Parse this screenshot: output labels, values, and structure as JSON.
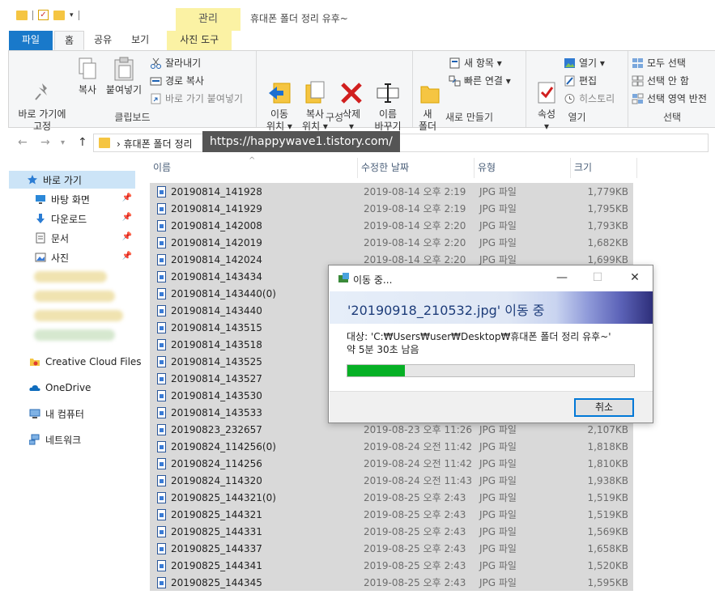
{
  "window": {
    "title": "휴대폰 폴더 정리 유후~",
    "contextual_tab": "관리"
  },
  "tabs": [
    "파일",
    "홈",
    "공유",
    "보기",
    "사진 도구"
  ],
  "ribbon": {
    "clipboard": {
      "pin": "바로 가기에\n고정",
      "copy": "복사",
      "paste": "붙여넣기",
      "cut": "잘라내기",
      "copy_path": "경로 복사",
      "paste_shortcut": "바로 가기 붙여넣기",
      "label": "클립보드"
    },
    "organize": {
      "move": "이동\n위치 ▾",
      "copy_to": "복사\n위치 ▾",
      "delete": "삭제\n▾",
      "rename": "이름\n바꾸기",
      "label": "구성"
    },
    "new": {
      "new_folder": "새\n폴더",
      "new_item": "새 항목 ▾",
      "easy_access": "빠른 연결 ▾",
      "label": "새로 만들기"
    },
    "open": {
      "properties": "속성\n▾",
      "open": "열기 ▾",
      "edit": "편집",
      "history": "히스토리",
      "label": "열기"
    },
    "select": {
      "select_all": "모두 선택",
      "select_none": "선택 안 함",
      "invert": "선택 영역 반전",
      "label": "선택"
    }
  },
  "address": {
    "crumb": "›  휴대폰 폴더 정리",
    "watermark": "https://happywave1.tistory.com/"
  },
  "nav": {
    "quick_access": "바로 가기",
    "pinned": [
      "바탕 화면",
      "다운로드",
      "문서",
      "사진"
    ],
    "creative_cloud": "Creative Cloud Files",
    "onedrive": "OneDrive",
    "this_pc": "내 컴퓨터",
    "network": "네트워크"
  },
  "columns": {
    "name": "이름",
    "date": "수정한 날짜",
    "type": "유형",
    "size": "크기"
  },
  "files": [
    {
      "name": "20190814_141928",
      "date": "2019-08-14 오후 2:19",
      "type": "JPG 파일",
      "size": "1,779KB"
    },
    {
      "name": "20190814_141929",
      "date": "2019-08-14 오후 2:19",
      "type": "JPG 파일",
      "size": "1,795KB"
    },
    {
      "name": "20190814_142008",
      "date": "2019-08-14 오후 2:20",
      "type": "JPG 파일",
      "size": "1,793KB"
    },
    {
      "name": "20190814_142019",
      "date": "2019-08-14 오후 2:20",
      "type": "JPG 파일",
      "size": "1,682KB"
    },
    {
      "name": "20190814_142024",
      "date": "2019-08-14 오후 2:20",
      "type": "JPG 파일",
      "size": "1,699KB"
    },
    {
      "name": "20190814_143434",
      "date": "",
      "type": "",
      "size": ""
    },
    {
      "name": "20190814_143440(0)",
      "date": "",
      "type": "",
      "size": ""
    },
    {
      "name": "20190814_143440",
      "date": "",
      "type": "",
      "size": ""
    },
    {
      "name": "20190814_143515",
      "date": "",
      "type": "",
      "size": ""
    },
    {
      "name": "20190814_143518",
      "date": "",
      "type": "",
      "size": ""
    },
    {
      "name": "20190814_143525",
      "date": "",
      "type": "",
      "size": ""
    },
    {
      "name": "20190814_143527",
      "date": "",
      "type": "",
      "size": ""
    },
    {
      "name": "20190814_143530",
      "date": "",
      "type": "",
      "size": ""
    },
    {
      "name": "20190814_143533",
      "date": "",
      "type": "",
      "size": ""
    },
    {
      "name": "20190823_232657",
      "date": "2019-08-23 오후 11:26",
      "type": "JPG 파일",
      "size": "2,107KB"
    },
    {
      "name": "20190824_114256(0)",
      "date": "2019-08-24 오전 11:42",
      "type": "JPG 파일",
      "size": "1,818KB"
    },
    {
      "name": "20190824_114256",
      "date": "2019-08-24 오전 11:42",
      "type": "JPG 파일",
      "size": "1,810KB"
    },
    {
      "name": "20190824_114320",
      "date": "2019-08-24 오전 11:43",
      "type": "JPG 파일",
      "size": "1,938KB"
    },
    {
      "name": "20190825_144321(0)",
      "date": "2019-08-25 오후 2:43",
      "type": "JPG 파일",
      "size": "1,519KB"
    },
    {
      "name": "20190825_144321",
      "date": "2019-08-25 오후 2:43",
      "type": "JPG 파일",
      "size": "1,519KB"
    },
    {
      "name": "20190825_144331",
      "date": "2019-08-25 오후 2:43",
      "type": "JPG 파일",
      "size": "1,569KB"
    },
    {
      "name": "20190825_144337",
      "date": "2019-08-25 오후 2:43",
      "type": "JPG 파일",
      "size": "1,658KB"
    },
    {
      "name": "20190825_144341",
      "date": "2019-08-25 오후 2:43",
      "type": "JPG 파일",
      "size": "1,520KB"
    },
    {
      "name": "20190825_144345",
      "date": "2019-08-25 오후 2:43",
      "type": "JPG 파일",
      "size": "1,595KB"
    }
  ],
  "dialog": {
    "title": "이동 중...",
    "heading": "'20190918_210532.jpg' 이동 중",
    "destination": "대상: 'C:₩Users₩user₩Desktop₩휴대폰 폴더 정리 유후~'",
    "remaining": "약 5분 30초 남음",
    "progress": 0.2,
    "cancel": "취소"
  },
  "colors": {
    "file_tab": "#1979ca",
    "contextual": "#fbf2a4",
    "selection": "#d9d9d9",
    "progress": "#06b025"
  }
}
